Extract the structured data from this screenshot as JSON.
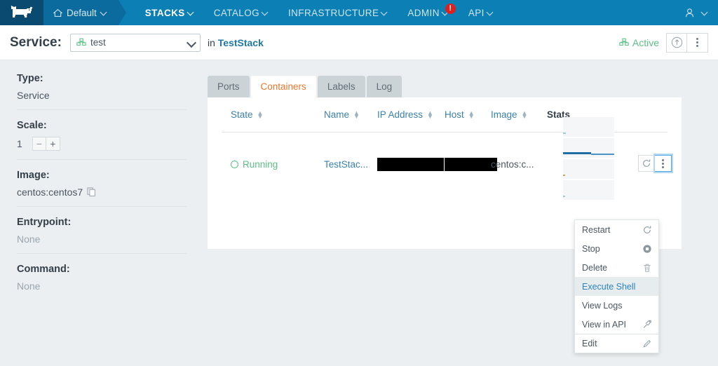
{
  "topnav": {
    "logo_icon": "rancher-cow-logo",
    "environment": {
      "label": "Default",
      "icon": "home-icon"
    },
    "items": [
      {
        "label": "STACKS",
        "active": true
      },
      {
        "label": "CATALOG",
        "active": false
      },
      {
        "label": "INFRASTRUCTURE",
        "active": false
      },
      {
        "label": "ADMIN",
        "active": false,
        "badge": "!"
      },
      {
        "label": "API",
        "active": false
      }
    ],
    "user_menu": {
      "icon": "user-icon",
      "chevron": "chevron-down-icon"
    },
    "colors": {
      "bar": "#0c7fb5",
      "logo_box": "#0b4a70",
      "env_box": "#0c6b9e",
      "badge": "#e01f1f"
    }
  },
  "page_header": {
    "title": "Service:",
    "service_select": {
      "value": "test",
      "icon": "stack-icon"
    },
    "in_label": "in",
    "stack_name": "TestStack",
    "state": {
      "label": "Active",
      "icon": "stack-icon",
      "color": "#5ac184"
    },
    "buttons": [
      {
        "name": "upgrade-button",
        "icon": "arrow-up-circle-icon"
      },
      {
        "name": "actions-button",
        "icon": "kebab-icon"
      }
    ]
  },
  "sidebar": {
    "fields": [
      {
        "key": "Type:",
        "value": "Service",
        "muted": false
      },
      {
        "key": "Scale:",
        "value": "1",
        "muted": false,
        "stepper": {
          "minus": "−",
          "plus": "+"
        }
      },
      {
        "key": "Image:",
        "value": "centos:centos7",
        "muted": false,
        "copy_icon": "copy-icon"
      },
      {
        "key": "Entrypoint:",
        "value": "None",
        "muted": true
      },
      {
        "key": "Command:",
        "value": "None",
        "muted": true
      }
    ]
  },
  "main": {
    "tabs": [
      {
        "label": "Ports",
        "active": false
      },
      {
        "label": "Containers",
        "active": true
      },
      {
        "label": "Labels",
        "active": false
      },
      {
        "label": "Log",
        "active": false
      }
    ],
    "table": {
      "columns": [
        {
          "label": "State",
          "sortable": true
        },
        {
          "label": "Name",
          "sortable": true
        },
        {
          "label": "IP Address",
          "sortable": true
        },
        {
          "label": "Host",
          "sortable": true
        },
        {
          "label": "Image",
          "sortable": true
        },
        {
          "label": "Stats",
          "sortable": false
        }
      ],
      "rows": [
        {
          "state": "Running",
          "name": "TestStac...",
          "ip_address": "",
          "host": "",
          "image": "centos:c...",
          "redacted": [
            "ip_address",
            "host"
          ]
        }
      ]
    },
    "row_actions": [
      {
        "name": "restart-button",
        "icon": "restart-icon",
        "focused": false
      },
      {
        "name": "container-menu-button",
        "icon": "kebab-icon",
        "focused": true
      }
    ]
  },
  "context_menu": {
    "items": [
      {
        "label": "Restart",
        "icon": "restart-icon",
        "selected": false,
        "separator_before": false
      },
      {
        "label": "Stop",
        "icon": "stop-icon",
        "selected": false,
        "separator_before": false
      },
      {
        "label": "Delete",
        "icon": "trash-icon",
        "selected": false,
        "separator_before": false
      },
      {
        "label": "Execute Shell",
        "icon": "",
        "selected": true,
        "separator_before": false
      },
      {
        "label": "View Logs",
        "icon": "",
        "selected": false,
        "separator_before": false
      },
      {
        "label": "View in API",
        "icon": "external-link-icon",
        "selected": false,
        "separator_before": false
      },
      {
        "label": "Edit",
        "icon": "pencil-icon",
        "selected": false,
        "separator_before": true
      }
    ]
  }
}
